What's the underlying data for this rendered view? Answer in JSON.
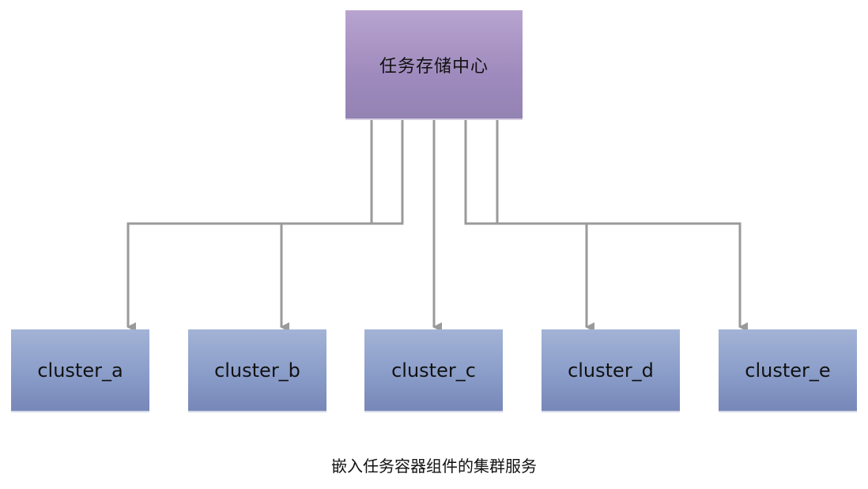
{
  "diagram": {
    "source_node": {
      "label": "任务存储中心"
    },
    "target_nodes": [
      {
        "label": "cluster_a"
      },
      {
        "label": "cluster_b"
      },
      {
        "label": "cluster_c"
      },
      {
        "label": "cluster_d"
      },
      {
        "label": "cluster_e"
      }
    ],
    "edges": [
      {
        "from": "任务存储中心",
        "to": "cluster_a"
      },
      {
        "from": "任务存储中心",
        "to": "cluster_b"
      },
      {
        "from": "任务存储中心",
        "to": "cluster_c"
      },
      {
        "from": "任务存储中心",
        "to": "cluster_d"
      },
      {
        "from": "任务存储中心",
        "to": "cluster_e"
      }
    ],
    "caption": "嵌入任务容器组件的集群服务",
    "colors": {
      "source_fill": "#a893c4",
      "target_fill": "#8c9ecb",
      "connector": "#9a9a9a"
    }
  }
}
